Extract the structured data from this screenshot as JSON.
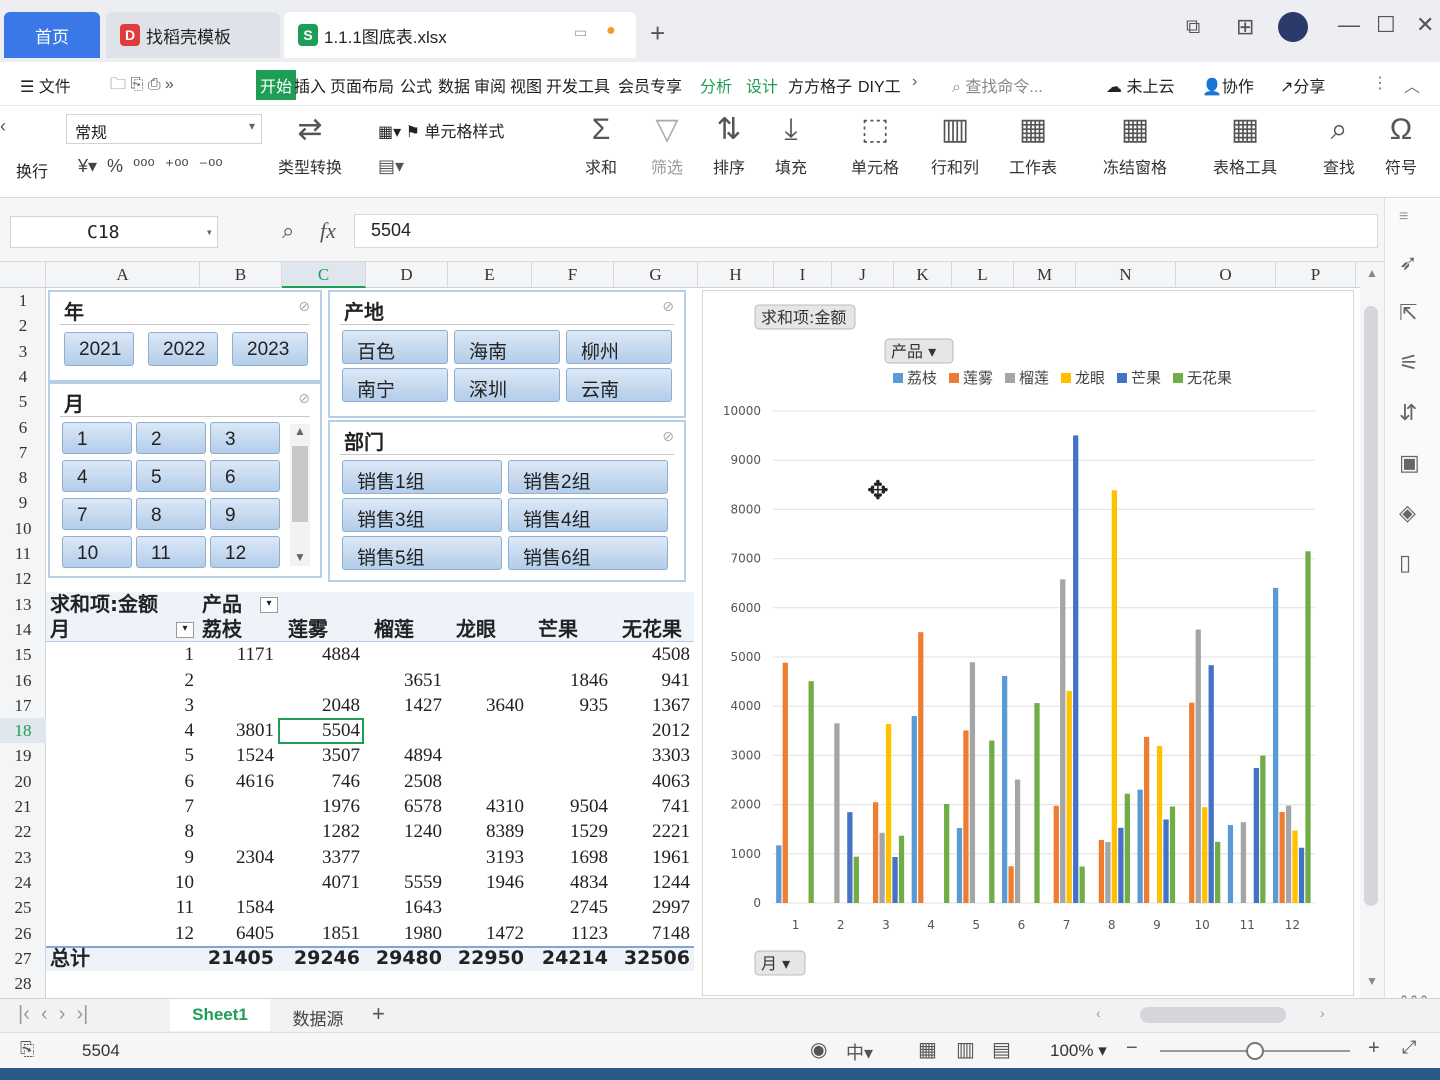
{
  "titlebar": {
    "tabs": [
      {
        "label": "首页"
      },
      {
        "label": "找稻壳模板"
      },
      {
        "label": "1.1.1图底表.xlsx"
      }
    ],
    "new_tab": "+"
  },
  "menu": {
    "items": [
      "文件",
      "开始",
      "插入",
      "页面布局",
      "公式",
      "数据",
      "审阅",
      "视图",
      "开发工具",
      "会员专享",
      "分析",
      "设计",
      "方方格子",
      "DIY工"
    ],
    "search": "查找命令...",
    "cloud": "未上云",
    "collab": "协作",
    "share": "分享"
  },
  "ribbon": {
    "number_format": "常规",
    "wrap": "换行",
    "type_convert": "类型转换",
    "cell_style": "单元格样式",
    "sum": "求和",
    "filter": "筛选",
    "sort": "排序",
    "fill": "填充",
    "cell": "单元格",
    "rowcol": "行和列",
    "sheet": "工作表",
    "freeze": "冻结窗格",
    "table_tool": "表格工具",
    "find": "查找",
    "symbol": "符号"
  },
  "formula": {
    "name_box": "C18",
    "fx": "fx",
    "value": "5504"
  },
  "columns": [
    "A",
    "B",
    "C",
    "D",
    "E",
    "F",
    "G",
    "H",
    "I",
    "J",
    "K",
    "L",
    "M",
    "N",
    "O",
    "P"
  ],
  "rows": [
    "1",
    "2",
    "3",
    "4",
    "5",
    "6",
    "7",
    "8",
    "9",
    "10",
    "11",
    "12",
    "13",
    "14",
    "15",
    "16",
    "17",
    "18",
    "19",
    "20",
    "21",
    "22",
    "23",
    "24",
    "25",
    "26",
    "27",
    "28"
  ],
  "slicers": {
    "year": {
      "title": "年",
      "items": [
        "2021",
        "2022",
        "2023"
      ]
    },
    "origin": {
      "title": "产地",
      "items": [
        "百色",
        "海南",
        "柳州",
        "南宁",
        "深圳",
        "云南"
      ]
    },
    "month": {
      "title": "月",
      "items": [
        "1",
        "2",
        "3",
        "4",
        "5",
        "6",
        "7",
        "8",
        "9",
        "10",
        "11",
        "12"
      ]
    },
    "dept": {
      "title": "部门",
      "items": [
        "销售1组",
        "销售2组",
        "销售3组",
        "销售4组",
        "销售5组",
        "销售6组"
      ]
    }
  },
  "pivot": {
    "corner": "求和项:金额",
    "col_field": "产品",
    "row_field": "月",
    "headers": [
      "荔枝",
      "莲雾",
      "榴莲",
      "龙眼",
      "芒果",
      "无花果"
    ],
    "rows": [
      [
        "1",
        "1171",
        "4884",
        "",
        "",
        "",
        "4508"
      ],
      [
        "2",
        "",
        "",
        "3651",
        "",
        "1846",
        "941"
      ],
      [
        "3",
        "",
        "2048",
        "1427",
        "3640",
        "935",
        "1367"
      ],
      [
        "4",
        "3801",
        "5504",
        "",
        "",
        "",
        "2012"
      ],
      [
        "5",
        "1524",
        "3507",
        "4894",
        "",
        "",
        "3303"
      ],
      [
        "6",
        "4616",
        "746",
        "2508",
        "",
        "",
        "4063"
      ],
      [
        "7",
        "",
        "1976",
        "6578",
        "4310",
        "9504",
        "741"
      ],
      [
        "8",
        "",
        "1282",
        "1240",
        "8389",
        "1529",
        "2221"
      ],
      [
        "9",
        "2304",
        "3377",
        "",
        "3193",
        "1698",
        "1961"
      ],
      [
        "10",
        "",
        "4071",
        "5559",
        "1946",
        "4834",
        "1244"
      ],
      [
        "11",
        "1584",
        "",
        "1643",
        "",
        "2745",
        "2997"
      ],
      [
        "12",
        "6405",
        "1851",
        "1980",
        "1472",
        "1123",
        "7148"
      ]
    ],
    "total_label": "总计",
    "totals": [
      "21405",
      "29246",
      "29480",
      "22950",
      "24214",
      "32506"
    ]
  },
  "chart_data": {
    "type": "bar",
    "title": "",
    "value_button": "求和项:金额",
    "legend_button": "产品",
    "axis_button": "月",
    "categories": [
      "1",
      "2",
      "3",
      "4",
      "5",
      "6",
      "7",
      "8",
      "9",
      "10",
      "11",
      "12"
    ],
    "ylim": [
      0,
      10000
    ],
    "yticks": [
      "0",
      "1000",
      "2000",
      "3000",
      "4000",
      "5000",
      "6000",
      "7000",
      "8000",
      "9000",
      "10000"
    ],
    "legend_position": "top",
    "series": [
      {
        "name": "荔枝",
        "color": "#5b9bd5",
        "values": [
          1171,
          0,
          0,
          3801,
          1524,
          4616,
          0,
          0,
          2304,
          0,
          1584,
          6405
        ]
      },
      {
        "name": "莲雾",
        "color": "#ed7d31",
        "values": [
          4884,
          0,
          2048,
          5504,
          3507,
          746,
          1976,
          1282,
          3377,
          4071,
          0,
          1851
        ]
      },
      {
        "name": "榴莲",
        "color": "#a5a5a5",
        "values": [
          0,
          3651,
          1427,
          0,
          4894,
          2508,
          6578,
          1240,
          0,
          5559,
          1643,
          1980
        ]
      },
      {
        "name": "龙眼",
        "color": "#ffc000",
        "values": [
          0,
          0,
          3640,
          0,
          0,
          0,
          4310,
          8389,
          3193,
          1946,
          0,
          1472
        ]
      },
      {
        "name": "芒果",
        "color": "#4472c4",
        "values": [
          0,
          1846,
          935,
          0,
          0,
          0,
          9504,
          1529,
          1698,
          4834,
          2745,
          1123
        ]
      },
      {
        "name": "无花果",
        "color": "#70ad47",
        "values": [
          4508,
          941,
          1367,
          2012,
          3303,
          4063,
          741,
          2221,
          1961,
          1244,
          2997,
          7148
        ]
      }
    ]
  },
  "sheets": {
    "tabs": [
      "Sheet1",
      "数据源"
    ],
    "add": "+"
  },
  "status": {
    "cell_value": "5504",
    "zoom": "100%",
    "input_mode": "中"
  }
}
